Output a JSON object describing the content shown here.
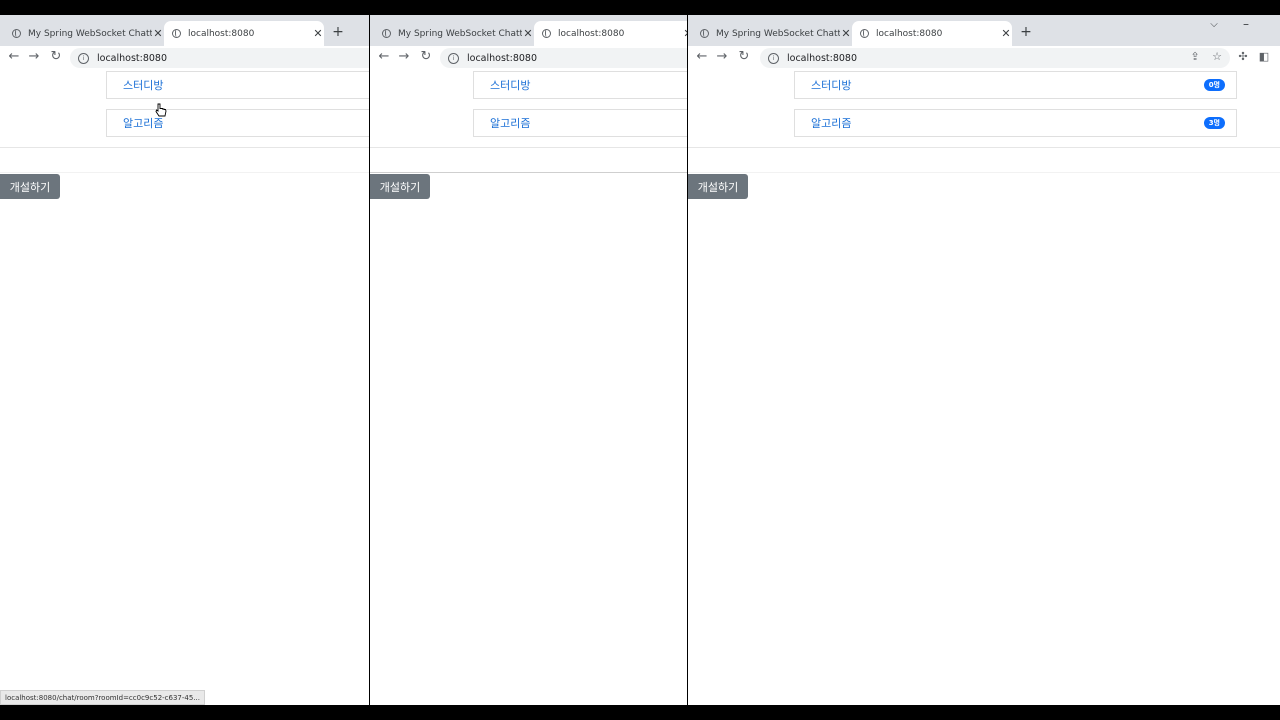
{
  "windows": [
    {
      "tabs": [
        {
          "title": "My Spring WebSocket Chatting"
        },
        {
          "title": "localhost:8080"
        }
      ],
      "address": "localhost:8080",
      "rooms": [
        {
          "name": "스터디방"
        },
        {
          "name": "알고리즘"
        }
      ],
      "open_button": "개설하기",
      "status_text": "localhost:8080/chat/room?roomId=cc0c9c52-c637-45..."
    },
    {
      "tabs": [
        {
          "title": "My Spring WebSocket Chatting"
        },
        {
          "title": "localhost:8080"
        }
      ],
      "address": "localhost:8080",
      "rooms": [
        {
          "name": "스터디방"
        },
        {
          "name": "알고리즘"
        }
      ],
      "open_button": "개설하기"
    },
    {
      "tabs": [
        {
          "title": "My Spring WebSocket Chatting"
        },
        {
          "title": "localhost:8080"
        }
      ],
      "address": "localhost:8080",
      "rooms": [
        {
          "name": "스터디방",
          "count": "0명"
        },
        {
          "name": "알고리즘",
          "count": "3명"
        }
      ],
      "open_button": "개설하기"
    }
  ],
  "icons": {
    "back": "arrow-left-icon",
    "forward": "arrow-right-icon",
    "reload": "reload-icon",
    "info": "info-icon",
    "share": "share-icon",
    "bookmark": "star-icon",
    "extensions": "puzzle-icon",
    "sidepanel": "side-panel-icon"
  },
  "colors": {
    "link": "#1a6fd6",
    "badge": "#0d6efd",
    "button": "#6c757d"
  }
}
